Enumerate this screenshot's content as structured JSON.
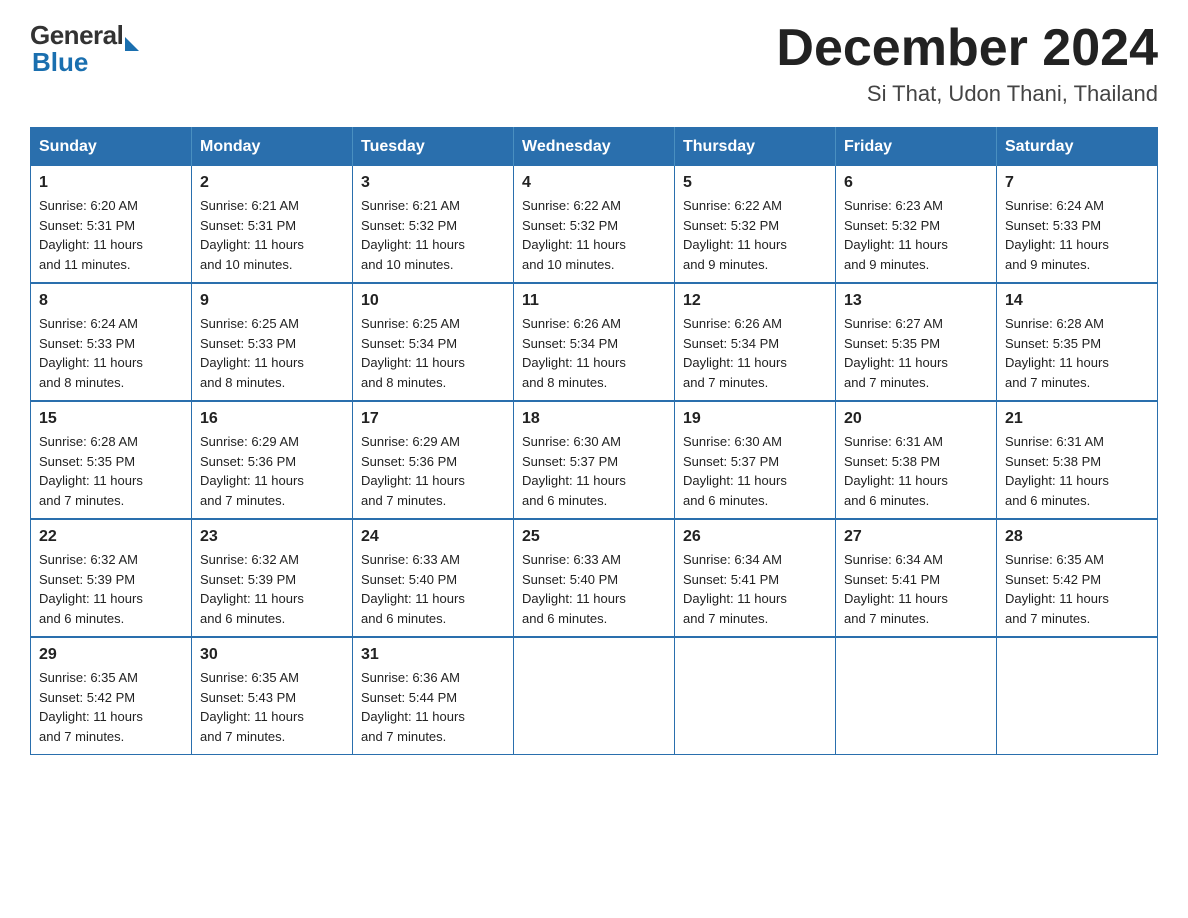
{
  "header": {
    "title": "December 2024",
    "subtitle": "Si That, Udon Thani, Thailand",
    "logo_general": "General",
    "logo_blue": "Blue"
  },
  "days_of_week": [
    "Sunday",
    "Monday",
    "Tuesday",
    "Wednesday",
    "Thursday",
    "Friday",
    "Saturday"
  ],
  "weeks": [
    [
      {
        "day": "1",
        "sunrise": "6:20 AM",
        "sunset": "5:31 PM",
        "daylight": "11 hours and 11 minutes."
      },
      {
        "day": "2",
        "sunrise": "6:21 AM",
        "sunset": "5:31 PM",
        "daylight": "11 hours and 10 minutes."
      },
      {
        "day": "3",
        "sunrise": "6:21 AM",
        "sunset": "5:32 PM",
        "daylight": "11 hours and 10 minutes."
      },
      {
        "day": "4",
        "sunrise": "6:22 AM",
        "sunset": "5:32 PM",
        "daylight": "11 hours and 10 minutes."
      },
      {
        "day": "5",
        "sunrise": "6:22 AM",
        "sunset": "5:32 PM",
        "daylight": "11 hours and 9 minutes."
      },
      {
        "day": "6",
        "sunrise": "6:23 AM",
        "sunset": "5:32 PM",
        "daylight": "11 hours and 9 minutes."
      },
      {
        "day": "7",
        "sunrise": "6:24 AM",
        "sunset": "5:33 PM",
        "daylight": "11 hours and 9 minutes."
      }
    ],
    [
      {
        "day": "8",
        "sunrise": "6:24 AM",
        "sunset": "5:33 PM",
        "daylight": "11 hours and 8 minutes."
      },
      {
        "day": "9",
        "sunrise": "6:25 AM",
        "sunset": "5:33 PM",
        "daylight": "11 hours and 8 minutes."
      },
      {
        "day": "10",
        "sunrise": "6:25 AM",
        "sunset": "5:34 PM",
        "daylight": "11 hours and 8 minutes."
      },
      {
        "day": "11",
        "sunrise": "6:26 AM",
        "sunset": "5:34 PM",
        "daylight": "11 hours and 8 minutes."
      },
      {
        "day": "12",
        "sunrise": "6:26 AM",
        "sunset": "5:34 PM",
        "daylight": "11 hours and 7 minutes."
      },
      {
        "day": "13",
        "sunrise": "6:27 AM",
        "sunset": "5:35 PM",
        "daylight": "11 hours and 7 minutes."
      },
      {
        "day": "14",
        "sunrise": "6:28 AM",
        "sunset": "5:35 PM",
        "daylight": "11 hours and 7 minutes."
      }
    ],
    [
      {
        "day": "15",
        "sunrise": "6:28 AM",
        "sunset": "5:35 PM",
        "daylight": "11 hours and 7 minutes."
      },
      {
        "day": "16",
        "sunrise": "6:29 AM",
        "sunset": "5:36 PM",
        "daylight": "11 hours and 7 minutes."
      },
      {
        "day": "17",
        "sunrise": "6:29 AM",
        "sunset": "5:36 PM",
        "daylight": "11 hours and 7 minutes."
      },
      {
        "day": "18",
        "sunrise": "6:30 AM",
        "sunset": "5:37 PM",
        "daylight": "11 hours and 6 minutes."
      },
      {
        "day": "19",
        "sunrise": "6:30 AM",
        "sunset": "5:37 PM",
        "daylight": "11 hours and 6 minutes."
      },
      {
        "day": "20",
        "sunrise": "6:31 AM",
        "sunset": "5:38 PM",
        "daylight": "11 hours and 6 minutes."
      },
      {
        "day": "21",
        "sunrise": "6:31 AM",
        "sunset": "5:38 PM",
        "daylight": "11 hours and 6 minutes."
      }
    ],
    [
      {
        "day": "22",
        "sunrise": "6:32 AM",
        "sunset": "5:39 PM",
        "daylight": "11 hours and 6 minutes."
      },
      {
        "day": "23",
        "sunrise": "6:32 AM",
        "sunset": "5:39 PM",
        "daylight": "11 hours and 6 minutes."
      },
      {
        "day": "24",
        "sunrise": "6:33 AM",
        "sunset": "5:40 PM",
        "daylight": "11 hours and 6 minutes."
      },
      {
        "day": "25",
        "sunrise": "6:33 AM",
        "sunset": "5:40 PM",
        "daylight": "11 hours and 6 minutes."
      },
      {
        "day": "26",
        "sunrise": "6:34 AM",
        "sunset": "5:41 PM",
        "daylight": "11 hours and 7 minutes."
      },
      {
        "day": "27",
        "sunrise": "6:34 AM",
        "sunset": "5:41 PM",
        "daylight": "11 hours and 7 minutes."
      },
      {
        "day": "28",
        "sunrise": "6:35 AM",
        "sunset": "5:42 PM",
        "daylight": "11 hours and 7 minutes."
      }
    ],
    [
      {
        "day": "29",
        "sunrise": "6:35 AM",
        "sunset": "5:42 PM",
        "daylight": "11 hours and 7 minutes."
      },
      {
        "day": "30",
        "sunrise": "6:35 AM",
        "sunset": "5:43 PM",
        "daylight": "11 hours and 7 minutes."
      },
      {
        "day": "31",
        "sunrise": "6:36 AM",
        "sunset": "5:44 PM",
        "daylight": "11 hours and 7 minutes."
      },
      null,
      null,
      null,
      null
    ]
  ],
  "labels": {
    "sunrise": "Sunrise:",
    "sunset": "Sunset:",
    "daylight": "Daylight:"
  }
}
